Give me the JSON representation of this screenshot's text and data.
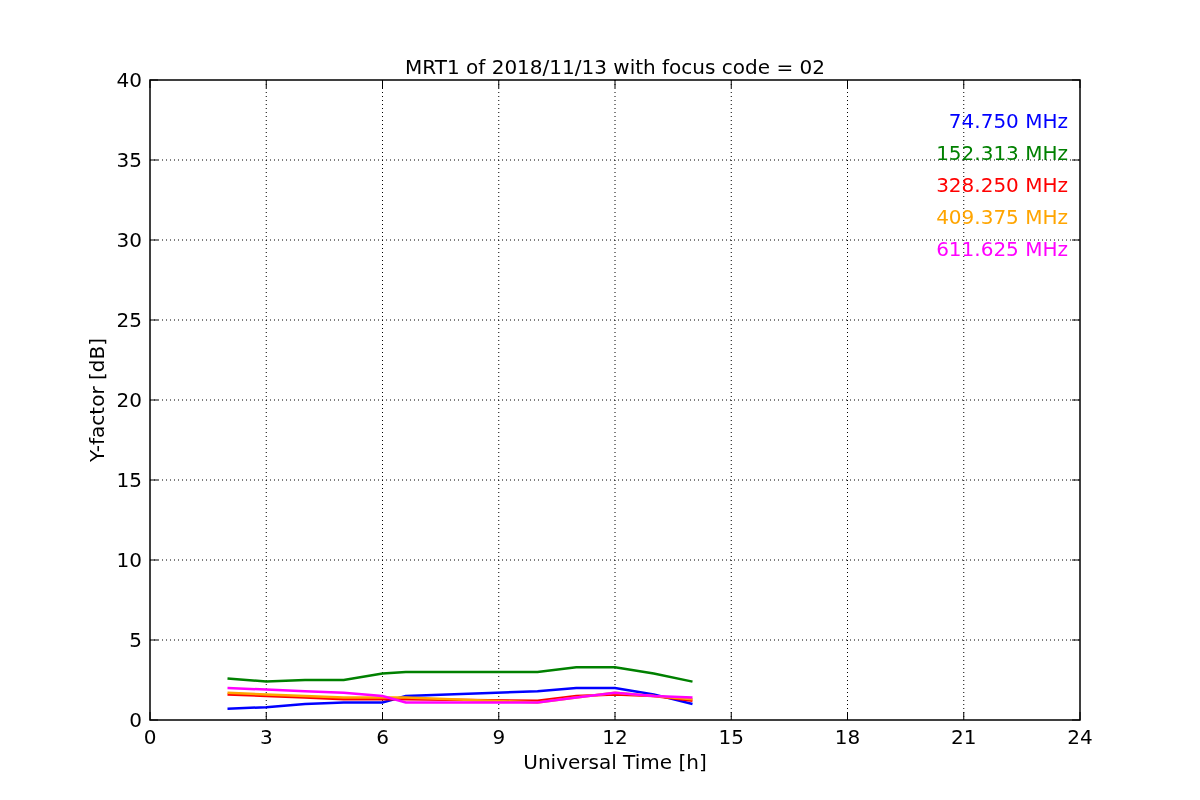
{
  "chart_data": {
    "type": "line",
    "title": "MRT1 of 2018/11/13 with focus code = 02",
    "xlabel": "Universal Time [h]",
    "ylabel": "Y-factor [dB]",
    "x": [
      2,
      3,
      4,
      5,
      6,
      6.6,
      10,
      11,
      12,
      13,
      14
    ],
    "series": [
      {
        "name": "74.750 MHz",
        "color": "#0000ff",
        "values": [
          0.7,
          0.8,
          1.0,
          1.1,
          1.1,
          1.5,
          1.8,
          2.0,
          2.0,
          1.6,
          1.0
        ]
      },
      {
        "name": "152.313 MHz",
        "color": "#008000",
        "values": [
          2.6,
          2.4,
          2.5,
          2.5,
          2.9,
          3.0,
          3.0,
          3.3,
          3.3,
          2.9,
          2.4
        ]
      },
      {
        "name": "328.250 MHz",
        "color": "#ff0000",
        "values": [
          1.6,
          1.5,
          1.4,
          1.3,
          1.3,
          1.3,
          1.2,
          1.5,
          1.6,
          1.5,
          1.2
        ]
      },
      {
        "name": "409.375 MHz",
        "color": "#ffa500",
        "values": [
          1.7,
          1.6,
          1.5,
          1.4,
          1.4,
          1.4,
          1.1,
          1.4,
          1.7,
          1.5,
          1.3
        ]
      },
      {
        "name": "611.625 MHz",
        "color": "#ff00ff",
        "values": [
          2.0,
          1.9,
          1.8,
          1.7,
          1.5,
          1.1,
          1.1,
          1.4,
          1.7,
          1.5,
          1.4
        ]
      }
    ],
    "grid": true,
    "xlim": [
      0,
      24
    ],
    "ylim": [
      0,
      40
    ],
    "xticks": [
      0,
      3,
      6,
      9,
      12,
      15,
      18,
      21,
      24
    ],
    "yticks": [
      0,
      5,
      10,
      15,
      20,
      25,
      30,
      35,
      40
    ]
  }
}
